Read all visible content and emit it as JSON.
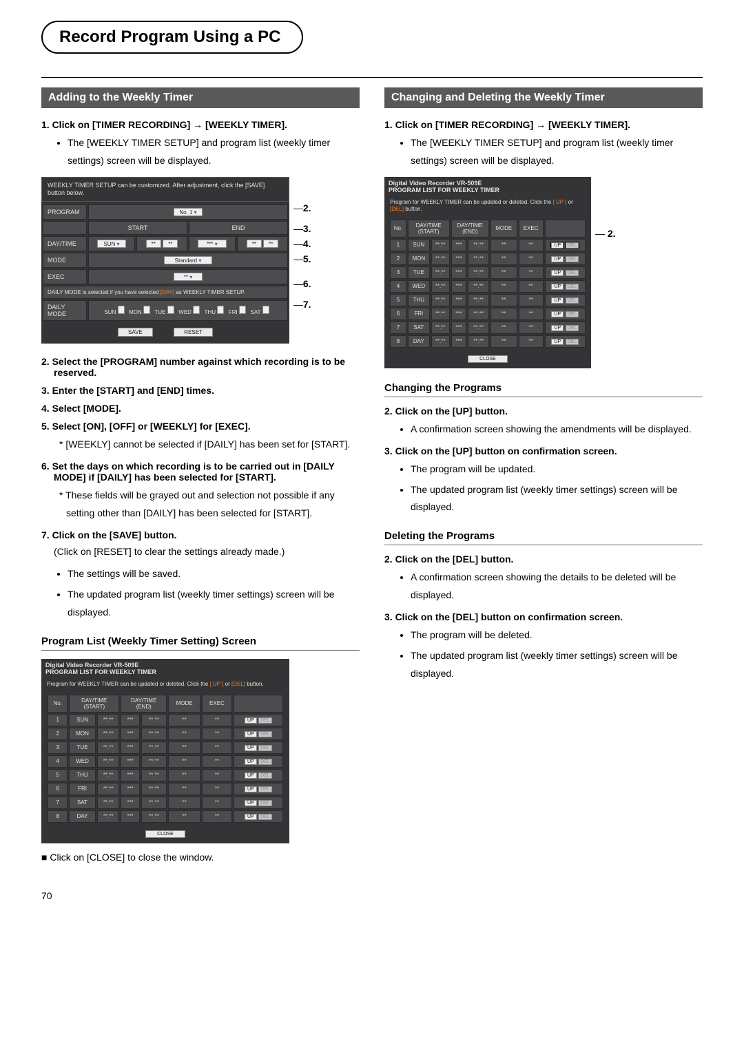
{
  "page": {
    "title": "Record Program Using a PC",
    "number": "70"
  },
  "left": {
    "bar": "Adding to the Weekly Timer",
    "step1": "1.  Click on [TIMER RECORDING] → [WEEKLY TIMER].",
    "b1a": "The [WEEKLY TIMER SETUP] and program list (weekly timer settings) screen will be displayed.",
    "step2": "2.  Select the [PROGRAM] number against which recording is to be reserved.",
    "step3": "3.  Enter the [START] and [END] times.",
    "step4": "4.  Select [MODE].",
    "step5": "5.  Select [ON], [OFF] or [WEEKLY] for [EXEC].",
    "star5": "* [WEEKLY] cannot be selected if [DAILY] has been set for [START].",
    "step6": "6.  Set the days on which recording is to be carried out in [DAILY MODE] if [DAILY] has been selected for [START].",
    "star6": "* These fields will be grayed out and selection not possible if any setting other than [DAILY] has been selected for [START].",
    "step7": "7.  Click on the [SAVE] button.",
    "p7a": "(Click on [RESET] to clear the settings already made.)",
    "b7a": "The settings will be saved.",
    "b7b": "The updated program list (weekly timer settings) screen will be displayed.",
    "sub": "Program List (Weekly Timer Setting) Screen",
    "close_note": "Click on [CLOSE] to close the window."
  },
  "right": {
    "bar": "Changing and Deleting the Weekly Timer",
    "step1": "1.  Click on [TIMER RECORDING] → [WEEKLY TIMER].",
    "b1a": "The [WEEKLY TIMER SETUP] and program list (weekly timer settings) screen will be displayed.",
    "subChange": "Changing the Programs",
    "ch2": "2.  Click on the [UP] button.",
    "ch2b": "A confirmation screen showing the amendments will be displayed.",
    "ch3": "3.  Click on the [UP] button on confirmation screen.",
    "ch3ba": "The program will be updated.",
    "ch3bb": "The updated program list (weekly timer settings) screen will be displayed.",
    "subDelete": "Deleting the Programs",
    "del2": "2.  Click on the [DEL] button.",
    "del2b": "A confirmation screen showing the details to be deleted will be displayed.",
    "del3": "3.  Click on the [DEL] button on confirmation screen.",
    "del3ba": "The program will be deleted.",
    "del3bb": "The updated program list (weekly timer settings) screen will be displayed."
  },
  "setup": {
    "tip": "WEEKLY TIMER SETUP can be customized. After adjustment, click the [SAVE] button below.",
    "program": "PROGRAM",
    "program_val": "No. 1",
    "start": "START",
    "end": "END",
    "daytime": "DAY/TIME",
    "day_val": "SUN",
    "mode": "MODE",
    "mode_val": "Standard",
    "exec": "EXEC",
    "exec_val": "**",
    "note": "DAILY MODE is selected if you have selected [DAY] as WEEKLY TIMER SETUP.",
    "daily_mode": "DAILY\nMODE",
    "days": [
      "SUN",
      "MON",
      "TUE",
      "WED",
      "THU",
      "FRI",
      "SAT"
    ],
    "save": "SAVE",
    "reset": "RESET"
  },
  "proglist": {
    "device": "Digital Video Recorder VR-509E",
    "title": "PROGRAM LIST FOR WEEKLY TIMER",
    "tip_a": "Program for WEEKLY TIMER can be updated or deleted. Click the ",
    "tip_up": "[ UP ]",
    "tip_b": " or ",
    "tip_del": "[DEL]",
    "tip_c": " button.",
    "head": [
      "No.",
      "DAY/TIME\n(START)",
      "",
      "DAY/TIME\n(END)",
      "",
      "MODE",
      "EXEC",
      ""
    ],
    "rows": [
      {
        "no": "1",
        "d": "SUN"
      },
      {
        "no": "2",
        "d": "MON"
      },
      {
        "no": "3",
        "d": "TUE"
      },
      {
        "no": "4",
        "d": "WED"
      },
      {
        "no": "5",
        "d": "THU"
      },
      {
        "no": "6",
        "d": "FRI"
      },
      {
        "no": "7",
        "d": "SAT"
      },
      {
        "no": "8",
        "d": "DAY"
      }
    ],
    "up": "UP",
    "del": "DEL",
    "close": "CLOSE"
  },
  "callouts": {
    "c2": "2.",
    "c3": "3.",
    "c4": "4.",
    "c5": "5.",
    "c6": "6.",
    "c7": "7."
  }
}
